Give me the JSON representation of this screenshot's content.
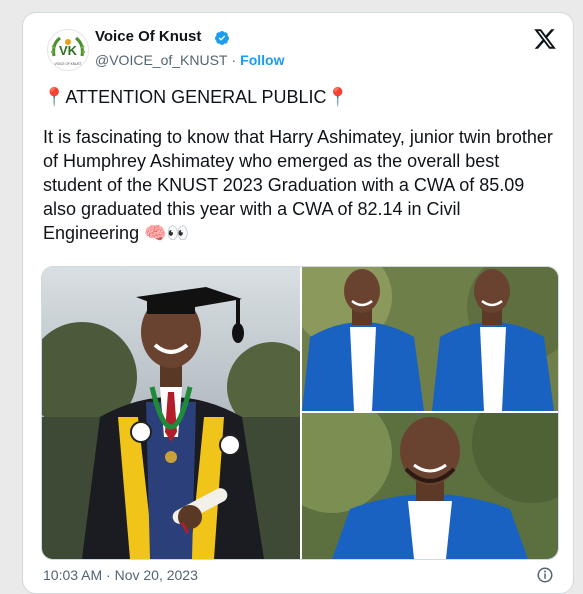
{
  "tweet": {
    "author_name": "Voice Of Knust",
    "handle": "@VOICE_of_KNUST",
    "separator": "·",
    "follow_label": "Follow",
    "headline": "ATTENTION GENERAL PUBLIC",
    "headline_emoji": "📍",
    "body": "It is fascinating to know that Harry Ashimatey, junior twin brother of Humphrey Ashimatey who emerged as the overall best student of the KNUST 2023 Graduation with a CWA of 85.09 also graduated this year with a CWA of 82.14 in Civil Engineering 🧠👀",
    "timestamp": "10:03 AM · Nov 20, 2023"
  },
  "avatar": {
    "logo_text": "VK",
    "caption": "VOICE OF KNUST"
  },
  "media": {
    "photos": [
      "graduate in gown photo",
      "twins in blue suits photo",
      "smiling man in blue suit photo"
    ]
  },
  "icons": {
    "verified": "verified-badge-icon",
    "brand": "x-logo-icon",
    "info": "info-icon"
  },
  "colors": {
    "link": "#1d9bf0",
    "secondary": "#536471",
    "text": "#0f1419"
  }
}
